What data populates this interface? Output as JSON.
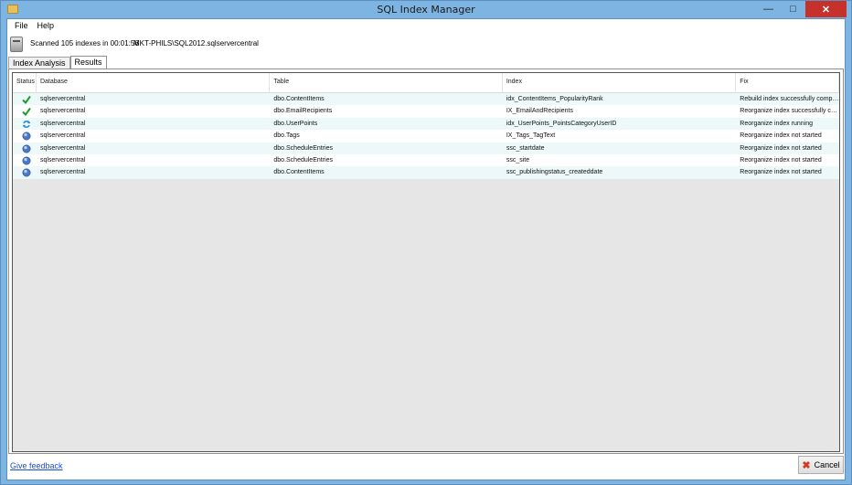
{
  "window": {
    "title": "SQL Index Manager"
  },
  "menu": {
    "file": "File",
    "help": "Help"
  },
  "info": {
    "scan_text": "Scanned 105 indexes in 00:01:56",
    "server_text": "MKT-PHILS\\SQL2012.sqlservercentral"
  },
  "tabs": {
    "analysis": "Index Analysis",
    "results": "Results"
  },
  "grid": {
    "headers": {
      "status": "Status",
      "database": "Database",
      "table": "Table",
      "index": "Index",
      "fix": "Fix"
    },
    "rows": [
      {
        "status_icon": "check-icon",
        "database": "sqlservercentral",
        "table": "dbo.ContentItems",
        "index": "idx_ContentItems_PopularityRank",
        "fix": "Rebuild index successfully completed"
      },
      {
        "status_icon": "check-icon",
        "database": "sqlservercentral",
        "table": "dbo.EmailRecipients",
        "index": "IX_EmailAndRecipients",
        "fix": "Reorganize index successfully comple..."
      },
      {
        "status_icon": "running-icon",
        "database": "sqlservercentral",
        "table": "dbo.UserPoints",
        "index": "idx_UserPoints_PointsCategoryUserID",
        "fix": "Reorganize index running"
      },
      {
        "status_icon": "pending-icon",
        "database": "sqlservercentral",
        "table": "dbo.Tags",
        "index": "IX_Tags_TagText",
        "fix": "Reorganize index not started"
      },
      {
        "status_icon": "pending-icon",
        "database": "sqlservercentral",
        "table": "dbo.ScheduleEntries",
        "index": "ssc_startdate",
        "fix": "Reorganize index not started"
      },
      {
        "status_icon": "pending-icon",
        "database": "sqlservercentral",
        "table": "dbo.ScheduleEntries",
        "index": "ssc_site",
        "fix": "Reorganize index not started"
      },
      {
        "status_icon": "pending-icon",
        "database": "sqlservercentral",
        "table": "dbo.ContentItems",
        "index": "ssc_publishingstatus_createddate",
        "fix": "Reorganize index not started"
      }
    ]
  },
  "footer": {
    "feedback": "Give feedback",
    "cancel": "Cancel"
  },
  "colors": {
    "titlebar": "#7eb4e2",
    "close": "#c7312b",
    "check": "#1f9a2a",
    "pending": "#4a78c8",
    "link": "#1a4fd1"
  }
}
